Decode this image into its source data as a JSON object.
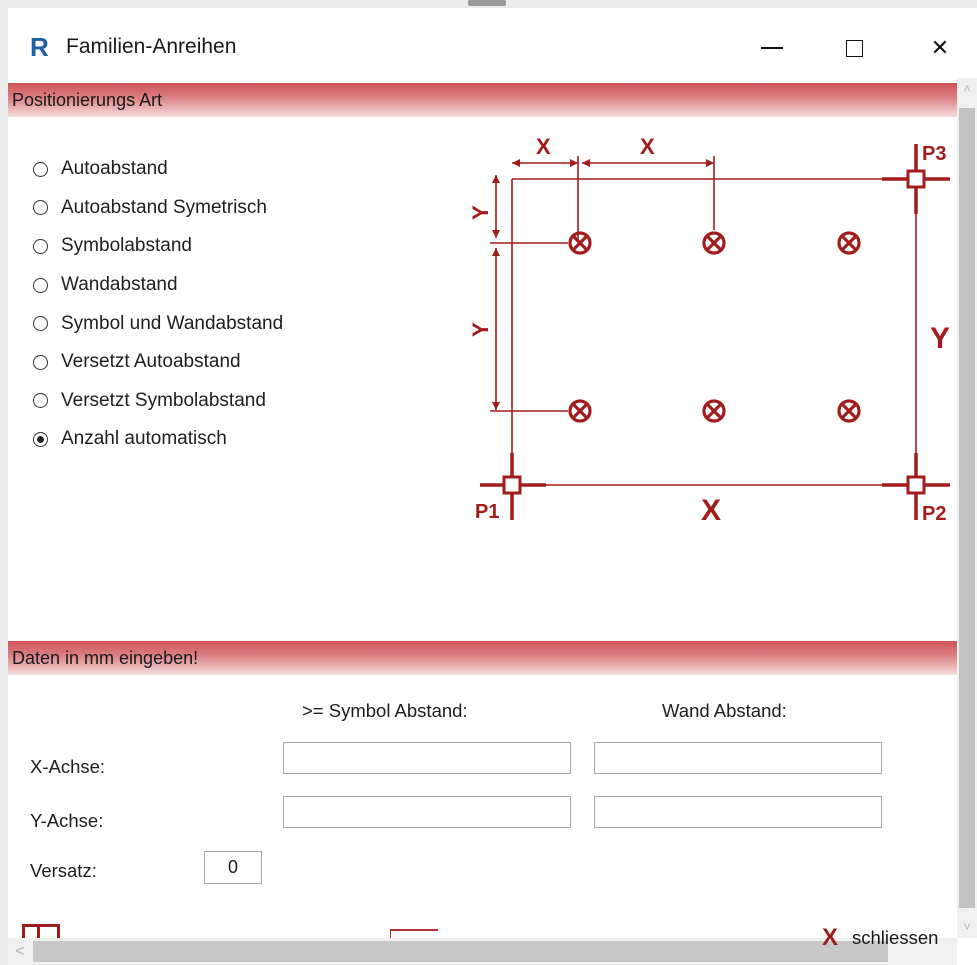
{
  "window": {
    "title": "Familien-Anreihen",
    "app_icon_letter": "R",
    "close_glyph": "✕"
  },
  "section1": {
    "title": "Positionierungs Art"
  },
  "positioning_options": [
    {
      "label": "Autoabstand",
      "selected": false
    },
    {
      "label": "Autoabstand Symetrisch",
      "selected": false
    },
    {
      "label": "Symbolabstand",
      "selected": false
    },
    {
      "label": "Wandabstand",
      "selected": false
    },
    {
      "label": "Symbol und Wandabstand",
      "selected": false
    },
    {
      "label": "Versetzt Autoabstand",
      "selected": false
    },
    {
      "label": "Versetzt Symbolabstand",
      "selected": false
    },
    {
      "label": "Anzahl automatisch",
      "selected": true
    }
  ],
  "diagram": {
    "dim_x": "X",
    "dim_y": "Y",
    "point_p1": "P1",
    "point_p2": "P2",
    "point_p3": "P3",
    "color": "#a31c1c"
  },
  "section2": {
    "title": "Daten in mm eingeben!"
  },
  "inputs": {
    "col_symbol": ">= Symbol Abstand:",
    "col_wall": "Wand Abstand:",
    "x_label": "X-Achse:",
    "y_label": "Y-Achse:",
    "offset_label": "Versatz:",
    "offset_value": "0",
    "x_symbol": "",
    "x_wall": "",
    "y_symbol": "",
    "y_wall": ""
  },
  "footer": {
    "close_icon_glyph": "X",
    "close_label": "schliessen"
  },
  "scrollbars": {
    "up_arrow": "˄",
    "down_arrow": "˅",
    "left_arrow": "<"
  }
}
